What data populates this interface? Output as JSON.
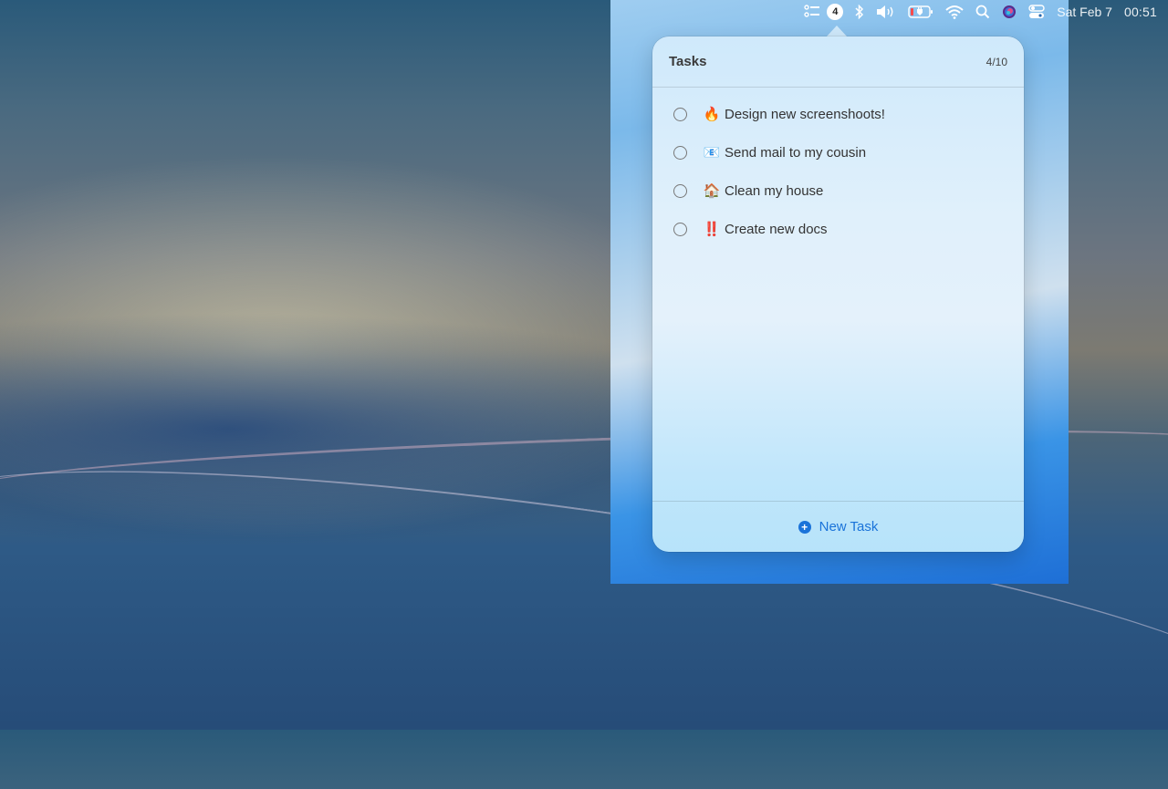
{
  "menubar": {
    "tasks_badge": "4",
    "date": "Sat Feb 7",
    "time": "00:51",
    "icons": [
      "tasks-list-icon",
      "bluetooth-icon",
      "volume-icon",
      "battery-charging-icon",
      "wifi-icon",
      "spotlight-search-icon",
      "siri-icon",
      "control-center-icon"
    ]
  },
  "popover": {
    "title": "Tasks",
    "count": "4/10",
    "tasks": [
      {
        "emoji": "🔥",
        "text": "Design new screenshoots!"
      },
      {
        "emoji": "📧",
        "text": "Send mail to my cousin"
      },
      {
        "emoji": "🏠",
        "text": "Clean my house"
      },
      {
        "emoji": "‼️",
        "text": "Create new docs"
      }
    ],
    "new_task_label": "New Task"
  },
  "colors": {
    "accent": "#1a73d9"
  }
}
